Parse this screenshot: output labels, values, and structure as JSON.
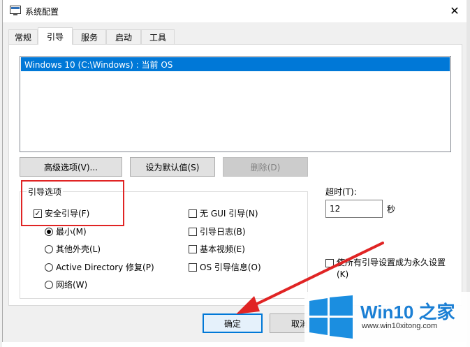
{
  "window": {
    "title": "系统配置",
    "close_glyph": "✕"
  },
  "tabs": [
    {
      "label": "常规",
      "active": false
    },
    {
      "label": "引导",
      "active": true
    },
    {
      "label": "服务",
      "active": false
    },
    {
      "label": "启动",
      "active": false
    },
    {
      "label": "工具",
      "active": false
    }
  ],
  "os_list": {
    "items": [
      "Windows 10 (C:\\Windows) : 当前 OS"
    ]
  },
  "buttons": {
    "advanced": "高级选项(V)...",
    "set_default": "设为默认值(S)",
    "delete": "删除(D)",
    "ok": "确定",
    "cancel": "取消"
  },
  "boot_options": {
    "label": "引导选项",
    "safe_boot": {
      "label": "安全引导(F)",
      "checked": true
    },
    "radios": [
      {
        "label": "最小(M)",
        "selected": true
      },
      {
        "label": "其他外壳(L)",
        "selected": false
      },
      {
        "label": "Active Directory 修复(P)",
        "selected": false
      },
      {
        "label": "网络(W)",
        "selected": false
      }
    ],
    "right_checks": [
      {
        "label": "无 GUI 引导(N)",
        "checked": false
      },
      {
        "label": "引导日志(B)",
        "checked": false
      },
      {
        "label": "基本视频(E)",
        "checked": false
      },
      {
        "label": "OS 引导信息(O)",
        "checked": false
      }
    ]
  },
  "timeout": {
    "label": "超时(T):",
    "value": "12",
    "unit": "秒"
  },
  "permanent": {
    "label": "使所有引导设置成为永久设置(K)",
    "checked": false
  },
  "watermark": {
    "brand": "Win10 之家",
    "url": "www.win10xitong.com"
  },
  "colors": {
    "accent": "#0078d7",
    "highlight": "#e02424",
    "brand_blue": "#1b7fd4"
  }
}
